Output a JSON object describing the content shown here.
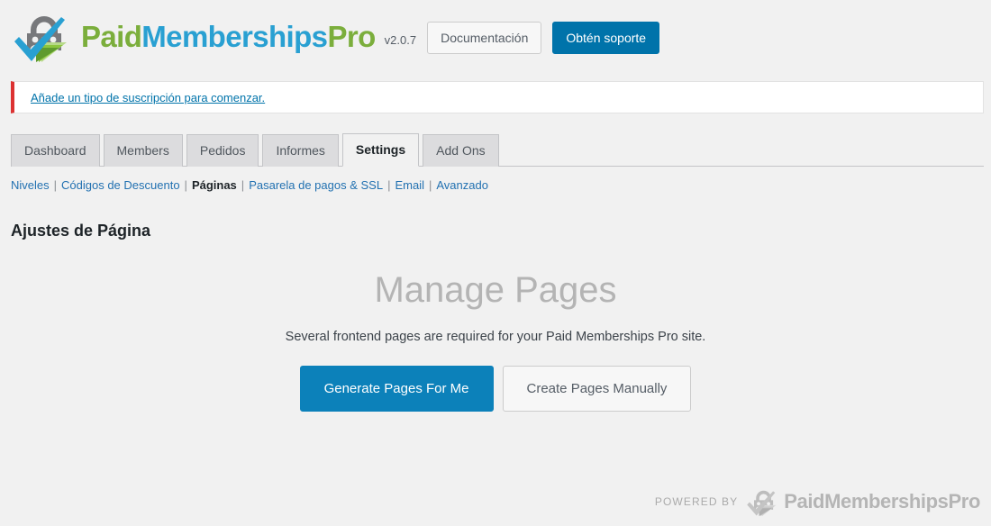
{
  "header": {
    "logo": {
      "icon": "pmpro-lock-people-check-logo",
      "word1": "Paid",
      "word2": "Memberships",
      "word3": "Pro",
      "color_green": "#7bae3c",
      "color_blue": "#29a0d2"
    },
    "version": "v2.0.7",
    "docs_button": "Documentación",
    "support_button": "Obtén soporte",
    "support_button_color": "#0073aa"
  },
  "notice": {
    "link_text": "Añade un tipo de suscripción para comenzar.",
    "accent_color": "#dc3232"
  },
  "tabs": [
    {
      "label": "Dashboard",
      "active": false
    },
    {
      "label": "Members",
      "active": false
    },
    {
      "label": "Pedidos",
      "active": false
    },
    {
      "label": "Informes",
      "active": false
    },
    {
      "label": "Settings",
      "active": true
    },
    {
      "label": "Add Ons",
      "active": false
    }
  ],
  "subnav": {
    "items": [
      {
        "label": "Niveles",
        "current": false
      },
      {
        "label": "Códigos de Descuento",
        "current": false
      },
      {
        "label": "Páginas",
        "current": true
      },
      {
        "label": "Pasarela de pagos & SSL",
        "current": false
      },
      {
        "label": "Email",
        "current": false
      },
      {
        "label": "Avanzado",
        "current": false
      }
    ],
    "separator": "|"
  },
  "page_title": "Ajustes de Página",
  "main": {
    "heading": "Manage Pages",
    "description": "Several frontend pages are required for your Paid Memberships Pro site.",
    "primary_button": "Generate Pages For Me",
    "secondary_button": "Create Pages Manually",
    "primary_button_color": "#0c81ba"
  },
  "footer": {
    "powered_by": "POWERED BY",
    "logo_icon": "pmpro-lock-people-check-logo-grayscale",
    "logo_text": "PaidMembershipsPro"
  }
}
